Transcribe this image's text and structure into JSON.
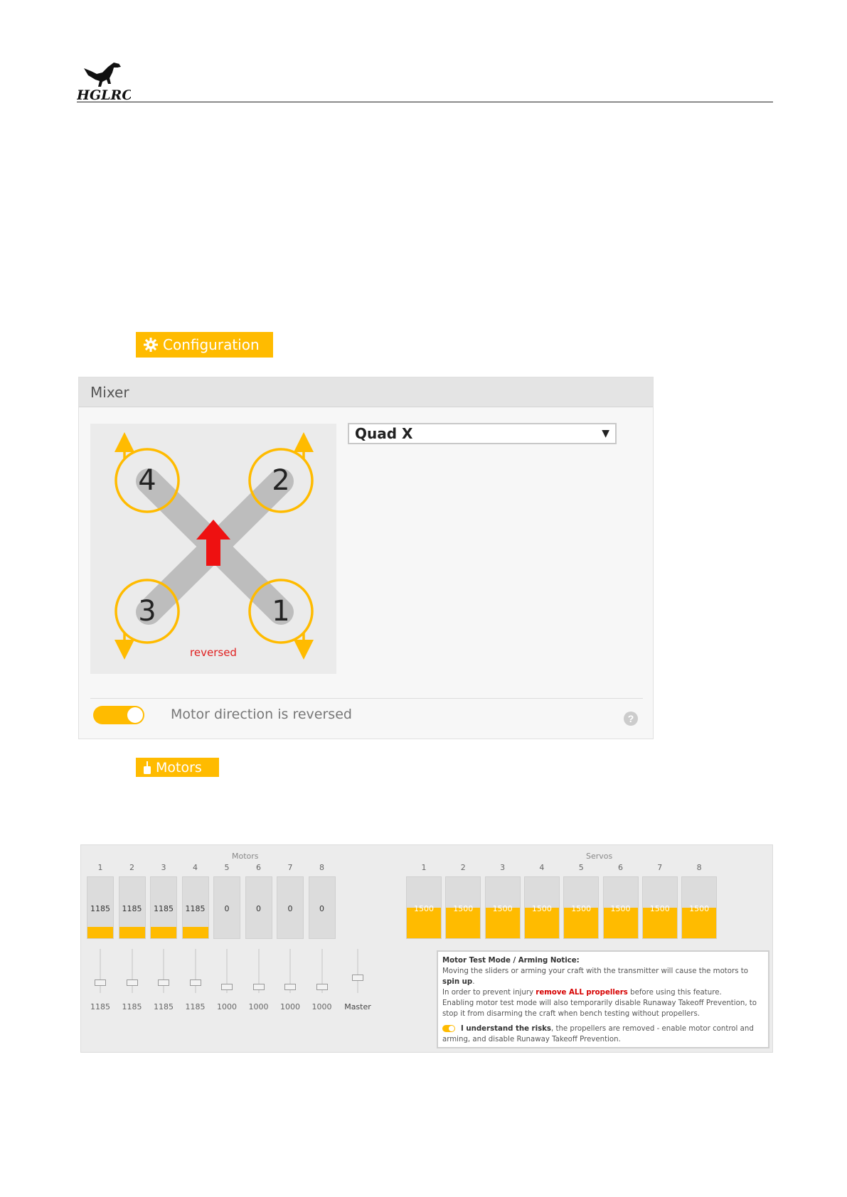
{
  "header": {
    "logo_text": "HGLRC"
  },
  "config_tag": {
    "label": "Configuration",
    "icon": "gear-icon"
  },
  "mixer": {
    "title": "Mixer",
    "selected_mixer": "Quad X",
    "diagram": {
      "motor_labels": [
        "4",
        "2",
        "3",
        "1"
      ],
      "reversed_label": "reversed",
      "colors": {
        "arms": "#bdbdbd",
        "rings": "#ffbb00",
        "arrow": "#ee1111",
        "reversed": "#e02020"
      }
    },
    "toggle": {
      "on": true,
      "label": "Motor direction is reversed"
    },
    "help_glyph": "?"
  },
  "motors_tag": {
    "label": "Motors",
    "icon": "motor-icon"
  },
  "motors": {
    "group_title": "Motors",
    "columns": [
      {
        "num": "1",
        "value": "1185",
        "level": 0.185,
        "slider": "1185"
      },
      {
        "num": "2",
        "value": "1185",
        "level": 0.185,
        "slider": "1185"
      },
      {
        "num": "3",
        "value": "1185",
        "level": 0.185,
        "slider": "1185"
      },
      {
        "num": "4",
        "value": "1185",
        "level": 0.185,
        "slider": "1185"
      },
      {
        "num": "5",
        "value": "0",
        "level": 0,
        "slider": "1000"
      },
      {
        "num": "6",
        "value": "0",
        "level": 0,
        "slider": "1000"
      },
      {
        "num": "7",
        "value": "0",
        "level": 0,
        "slider": "1000"
      },
      {
        "num": "8",
        "value": "0",
        "level": 0,
        "slider": "1000"
      }
    ],
    "master_label": "Master"
  },
  "servos": {
    "group_title": "Servos",
    "columns": [
      {
        "num": "1",
        "value": "1500",
        "level": 0.5
      },
      {
        "num": "2",
        "value": "1500",
        "level": 0.5
      },
      {
        "num": "3",
        "value": "1500",
        "level": 0.5
      },
      {
        "num": "4",
        "value": "1500",
        "level": 0.5
      },
      {
        "num": "5",
        "value": "1500",
        "level": 0.5
      },
      {
        "num": "6",
        "value": "1500",
        "level": 0.5
      },
      {
        "num": "7",
        "value": "1500",
        "level": 0.5
      },
      {
        "num": "8",
        "value": "1500",
        "level": 0.5
      }
    ]
  },
  "notice": {
    "title": "Motor Test Mode / Arming Notice:",
    "line1_a": "Moving the sliders or arming your craft with the transmitter will cause the motors to ",
    "line1_b": "spin up",
    "line1_c": ".",
    "line2_a": "In order to prevent injury ",
    "line2_b": "remove ALL propellers",
    "line2_c": " before using this feature.",
    "line3": "Enabling motor test mode will also temporarily disable Runaway Takeoff Prevention, to stop it from disarming the craft when bench testing without propellers.",
    "ack_a": "I understand the risks",
    "ack_b": ", the propellers are removed - enable motor control and arming, and disable Runaway Takeoff Prevention."
  }
}
